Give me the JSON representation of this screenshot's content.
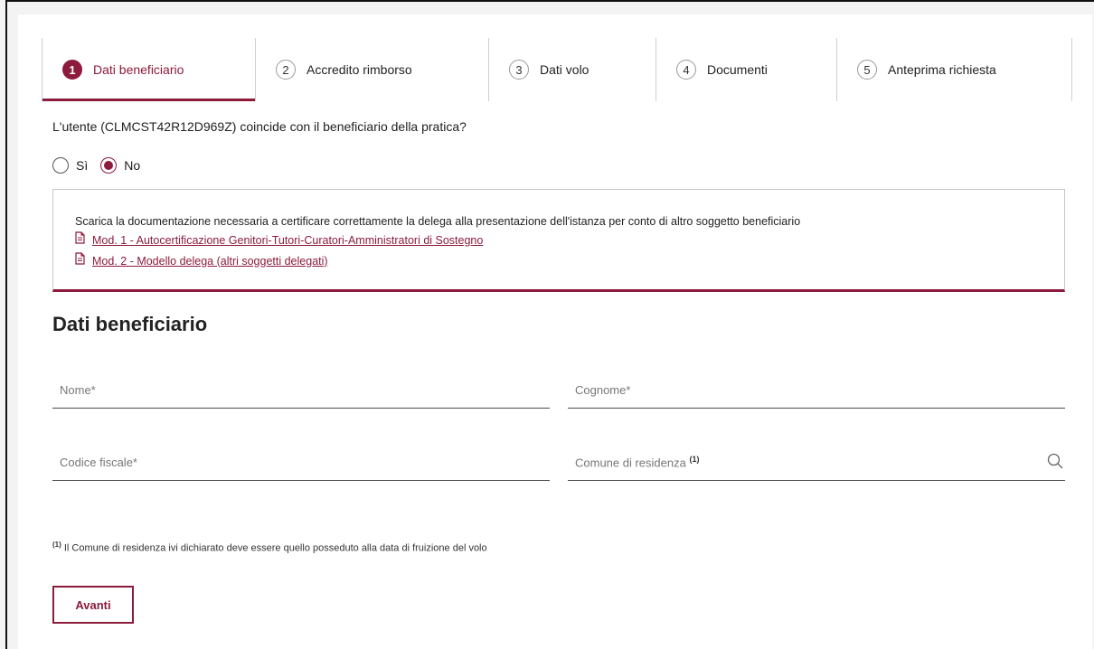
{
  "stepper": {
    "steps": [
      {
        "num": "1",
        "label": "Dati beneficiario"
      },
      {
        "num": "2",
        "label": "Accredito rimborso"
      },
      {
        "num": "3",
        "label": "Dati volo"
      },
      {
        "num": "4",
        "label": "Documenti"
      },
      {
        "num": "5",
        "label": "Anteprima richiesta"
      }
    ],
    "active_index": 0
  },
  "question": "L'utente (CLMCST42R12D969Z) coincide con il beneficiario della pratica?",
  "radio": {
    "options": [
      "Sì",
      "No"
    ],
    "selected": "No"
  },
  "notice": {
    "text": "Scarica la documentazione necessaria a certificare correttamente la delega alla presentazione dell'istanza per conto di altro soggetto beneficiario",
    "links": [
      "Mod. 1 - Autocertificazione Genitori-Tutori-Curatori-Amministratori di Sostegno",
      "Mod. 2 - Modello delega (altri soggetti delegati)"
    ]
  },
  "section": {
    "title": "Dati beneficiario"
  },
  "form": {
    "nome_placeholder": "Nome*",
    "cognome_placeholder": "Cognome*",
    "codice_fiscale_placeholder": "Codice fiscale*",
    "comune_label": "Comune di residenza",
    "comune_sup": "(1)"
  },
  "footnote": {
    "sup": "(1)",
    "text": "Il Comune di residenza ivi dichiarato deve essere quello posseduto alla data di fruizione del volo"
  },
  "buttons": {
    "next_label": "Avanti"
  },
  "colors": {
    "accent": "#8c1b3c"
  },
  "icons": {
    "file": "file-text-icon",
    "search": "search-icon"
  }
}
